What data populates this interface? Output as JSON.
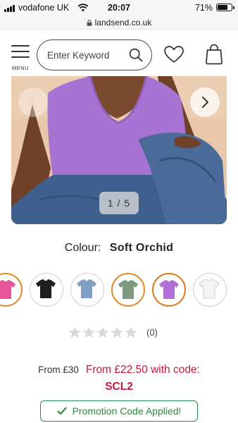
{
  "status_bar": {
    "carrier": "vodafone UK",
    "time": "20:07",
    "battery": "71%",
    "battery_level": 0.71
  },
  "browser": {
    "url": "landsend.co.uk"
  },
  "header": {
    "menu_label": "MENU",
    "search_placeholder": "Enter Keyword",
    "icons": [
      "menu-icon",
      "search-icon",
      "heart-icon",
      "shopping-bag-icon"
    ]
  },
  "gallery": {
    "counter": "1 / 5",
    "prev_icon": "chevron-left-icon",
    "next_icon": "chevron-right-icon"
  },
  "product": {
    "colour_label": "Colour:",
    "colour_value": "Soft Orchid",
    "swatches": [
      {
        "colour": "#e8559a",
        "ring": true,
        "selected": false
      },
      {
        "colour": "#1e1e1e",
        "ring": false,
        "selected": false
      },
      {
        "colour": "#7f9fc4",
        "ring": false,
        "selected": false
      },
      {
        "colour": "#7d9a7c",
        "ring": true,
        "selected": false
      },
      {
        "colour": "#b46fd6",
        "ring": true,
        "selected": true
      },
      {
        "colour": "#f4f4f4",
        "ring": false,
        "selected": false
      }
    ],
    "rating_stars": 0,
    "rating_max": 5,
    "review_count": "(0)",
    "price_from": "From £30",
    "price_promo": "From £22.50 with code:",
    "promo_code": "SCL2",
    "promo_applied": "Promotion Code Applied!"
  },
  "colors": {
    "accent_red": "#c8183c",
    "success_green": "#2e8a3c",
    "selected_ring": "#e07a1e"
  }
}
